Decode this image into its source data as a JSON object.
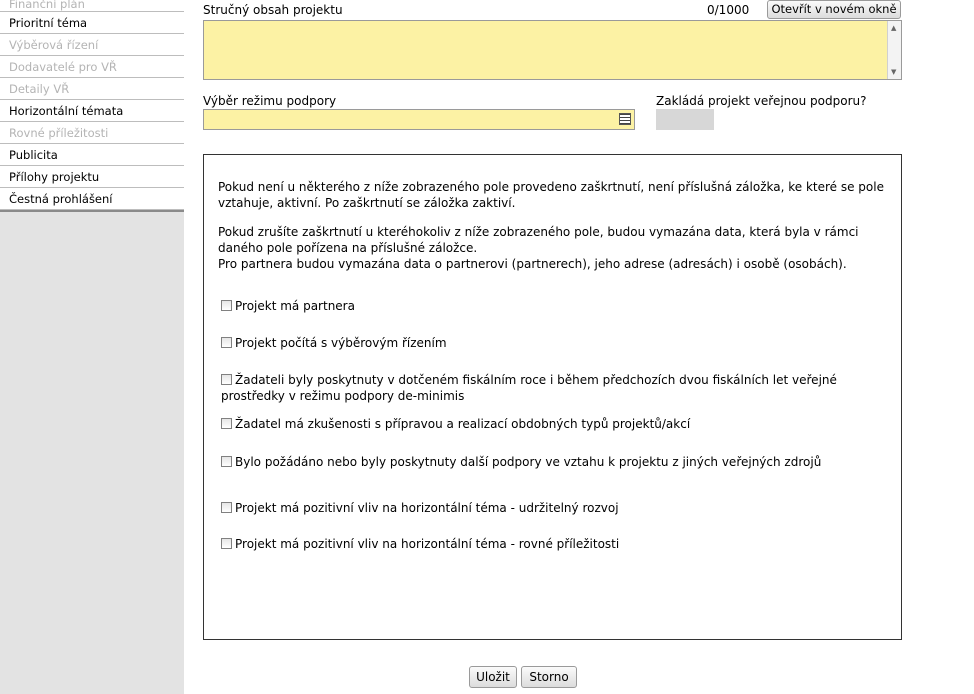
{
  "sidebar": {
    "items": [
      {
        "label": "Finanční plán",
        "enabled": false
      },
      {
        "label": "Prioritní téma",
        "enabled": true
      },
      {
        "label": "Výběrová řízení",
        "enabled": false
      },
      {
        "label": "Dodavatelé pro VŘ",
        "enabled": false
      },
      {
        "label": "Detaily VŘ",
        "enabled": false
      },
      {
        "label": "Horizontální témata",
        "enabled": true
      },
      {
        "label": "Rovné příležitosti",
        "enabled": false
      },
      {
        "label": "Publicita",
        "enabled": true
      },
      {
        "label": "Přílohy projektu",
        "enabled": true
      },
      {
        "label": "Čestná prohlášení",
        "enabled": true
      }
    ]
  },
  "summary": {
    "label": "Stručný obsah projektu",
    "counter": "0/1000",
    "open_button": "Otevřít v novém okně",
    "value": ""
  },
  "support_mode": {
    "label": "Výběr režimu podpory",
    "value": ""
  },
  "public_support": {
    "label": "Zakládá projekt veřejnou podporu?",
    "value": ""
  },
  "info": {
    "p1": "Pokud není u některého z níže zobrazeného pole provedeno zaškrtnutí, není příslušná záložka, ke které se pole vztahuje, aktivní. Po zaškrtnutí se záložka zaktiví.",
    "p2a": "Pokud zrušíte zaškrtnutí u kteréhokoliv z níže zobrazeného pole, budou vymazána data, která byla v rámci daného pole pořízena na příslušné záložce.",
    "p2b": "Pro partnera budou vymazána data o partnerovi (partnerech), jeho adrese (adresách) i osobě (osobách)."
  },
  "checkboxes": [
    {
      "label": "Projekt má partnera",
      "checked": false
    },
    {
      "label": "Projekt počítá s výběrovým řízením",
      "checked": false
    },
    {
      "label": "Žadateli byly poskytnuty v dotčeném fiskálním roce i během předchozích dvou fiskálních let veřejné prostředky v režimu podpory de-minimis",
      "checked": false
    },
    {
      "label": "Žadatel má zkušenosti s přípravou a realizací obdobných typů projektů/akcí",
      "checked": false
    },
    {
      "label": "Bylo požádáno nebo byly poskytnuty další podpory ve vztahu k projektu z jiných veřejných zdrojů",
      "checked": false
    },
    {
      "label": "Projekt má pozitivní vliv na horizontální téma - udržitelný rozvoj",
      "checked": false
    },
    {
      "label": "Projekt má pozitivní vliv na horizontální téma - rovné příležitosti",
      "checked": false
    }
  ],
  "buttons": {
    "save": "Uložit",
    "cancel": "Storno"
  }
}
